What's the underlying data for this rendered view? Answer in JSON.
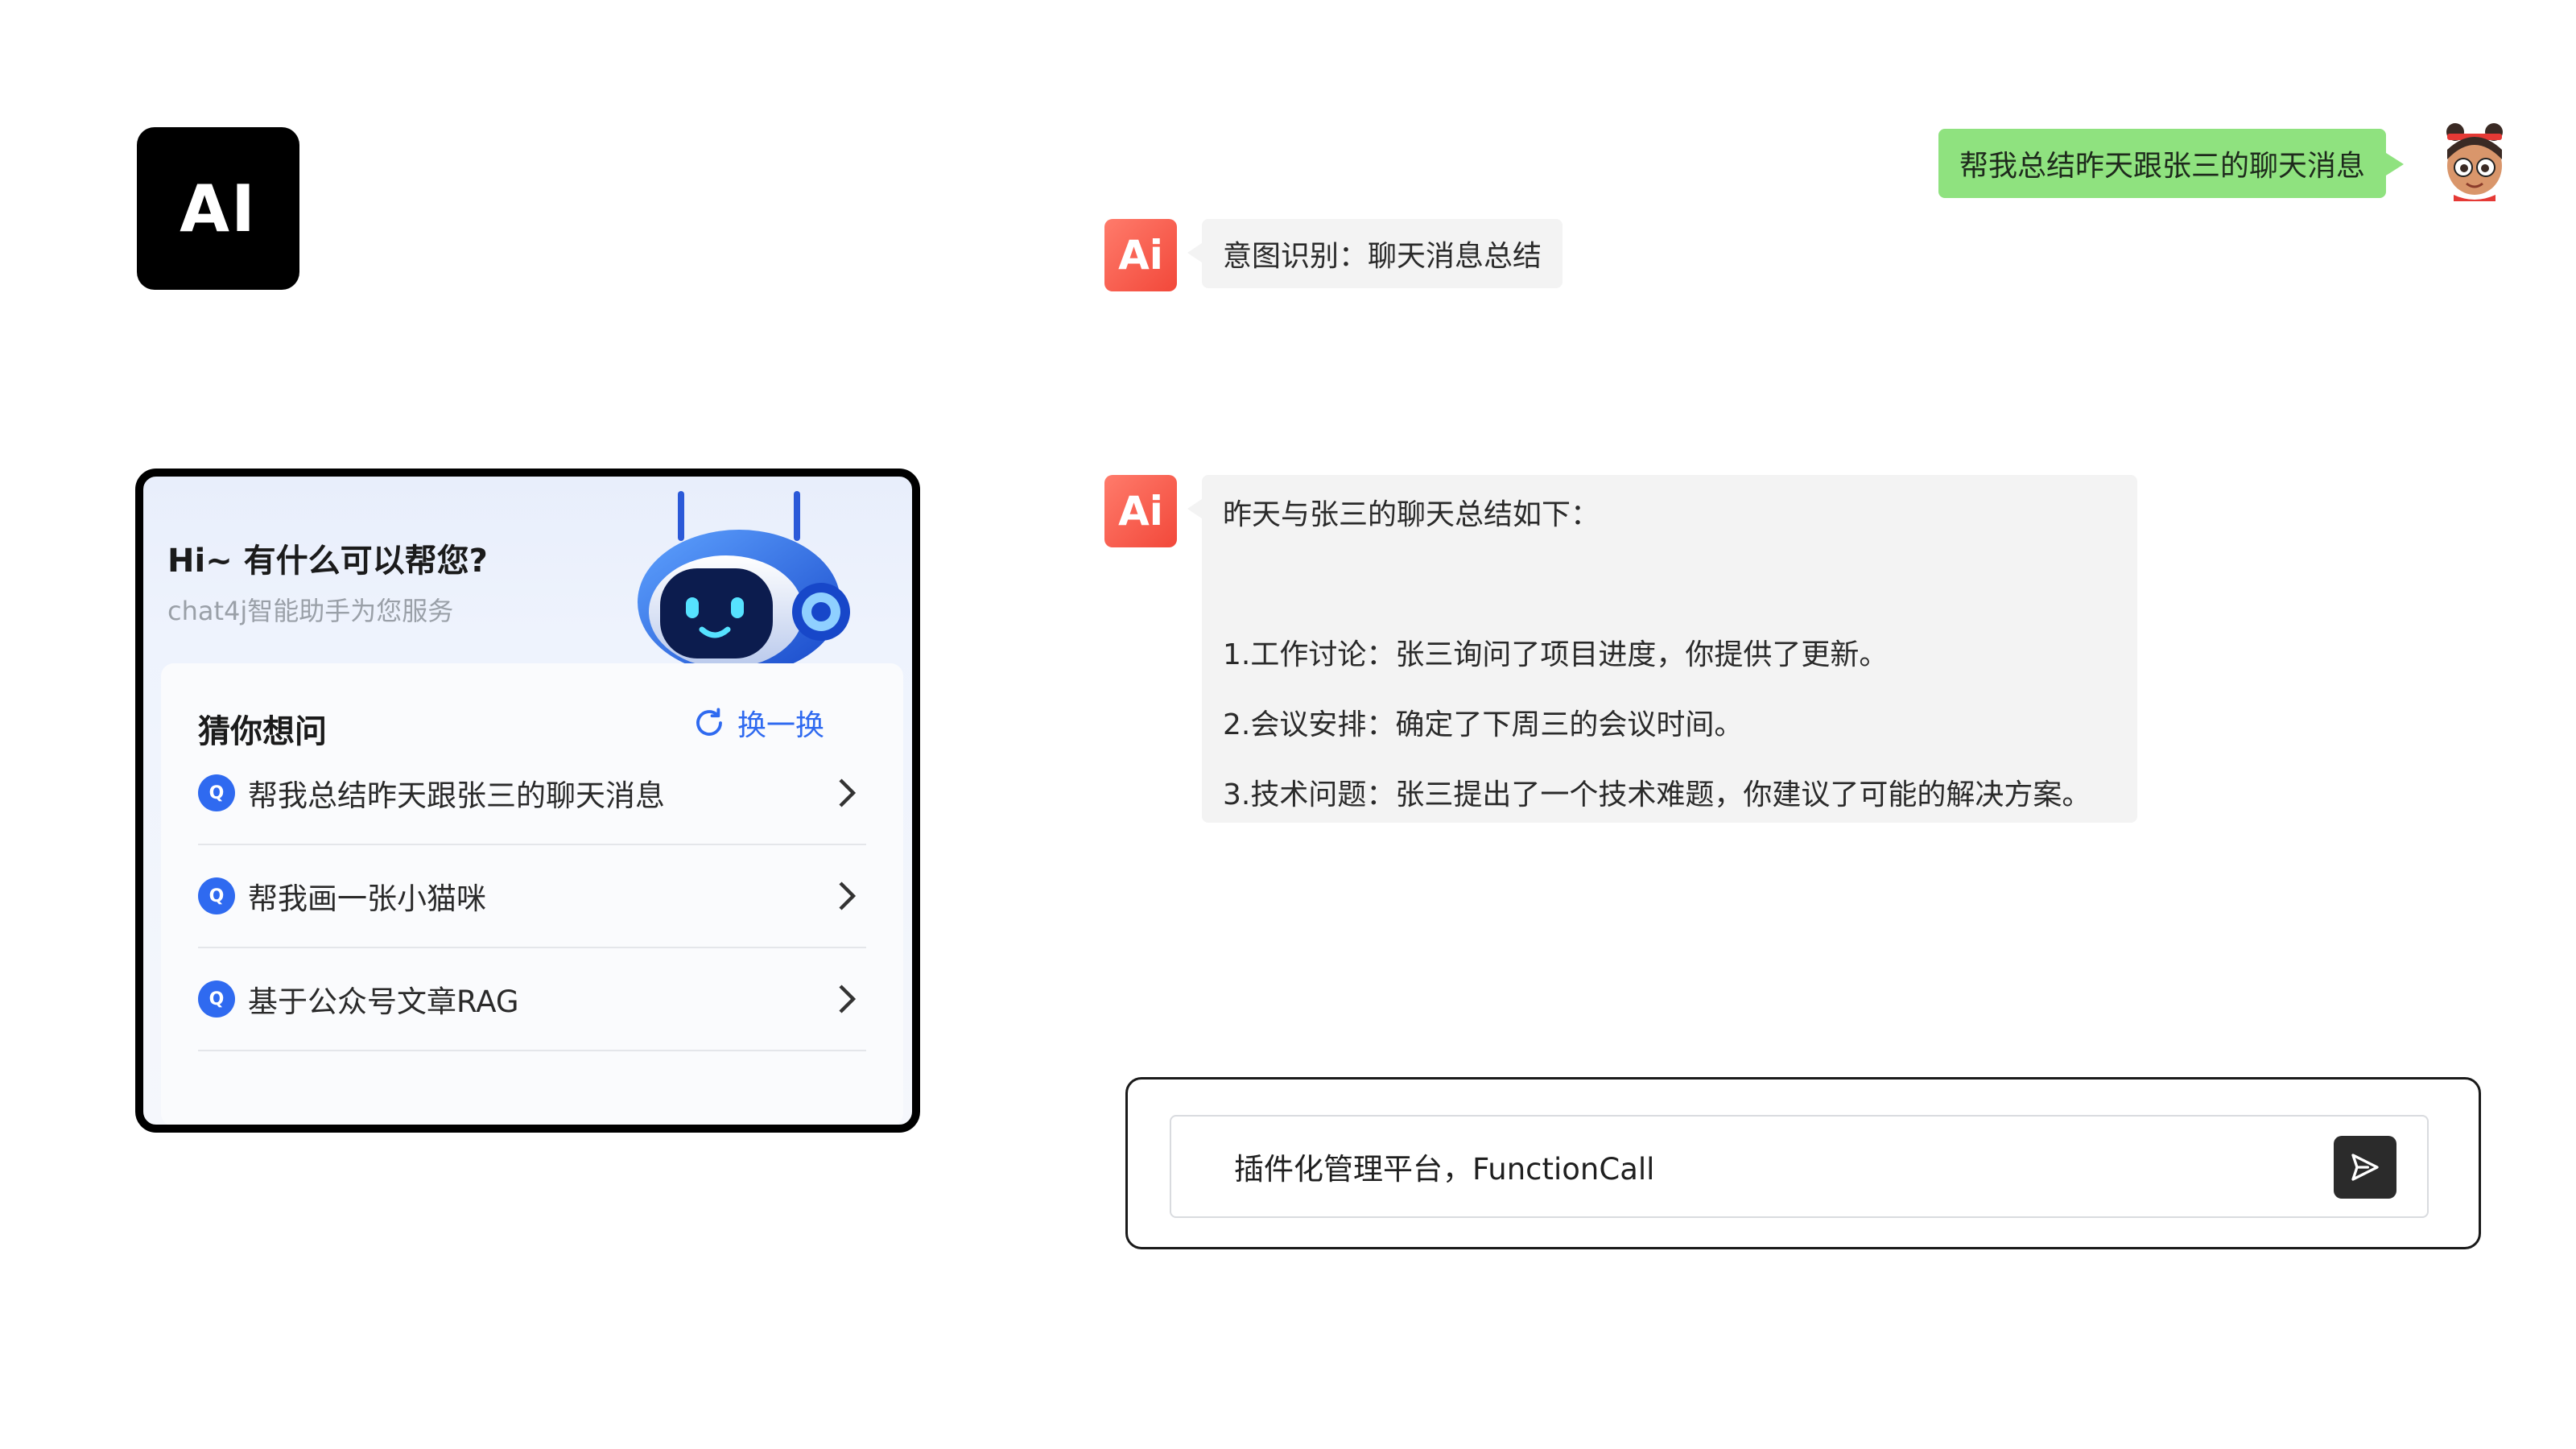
{
  "logo": {
    "text": "AI"
  },
  "assistant_card": {
    "title": "Hi~ 有什么可以帮您?",
    "subtitle": "chat4j智能助手为您服务",
    "suggest_heading": "猜你想问",
    "refresh_label": "换一换",
    "badge_letter": "Q",
    "suggestions": [
      {
        "label": "帮我总结昨天跟张三的聊天消息"
      },
      {
        "label": "帮我画一张小猫咪"
      },
      {
        "label": "基于公众号文章RAG"
      }
    ]
  },
  "chat": {
    "ai_avatar_text": "Ai",
    "user_message": "帮我总结昨天跟张三的聊天消息",
    "intent_message": "意图识别：聊天消息总结",
    "summary": {
      "intro": "昨天与张三的聊天总结如下：",
      "lines": [
        "1.工作讨论：张三询问了项目进度，你提供了更新。",
        "2.会议安排：确定了下周三的会议时间。",
        "3.技术问题：张三提出了一个技术难题，你建议了可能的解决方案。"
      ]
    }
  },
  "input": {
    "value": "插件化管理平台，FunctionCall"
  },
  "colors": {
    "accent_blue": "#2f6af0",
    "user_bubble": "#8fe27f",
    "ai_avatar": "#f2483a",
    "ai_bubble": "#f3f3f3"
  },
  "icons": [
    "robot-icon",
    "refresh-icon",
    "chevron-right-icon",
    "send-icon",
    "user-avatar-icon"
  ]
}
